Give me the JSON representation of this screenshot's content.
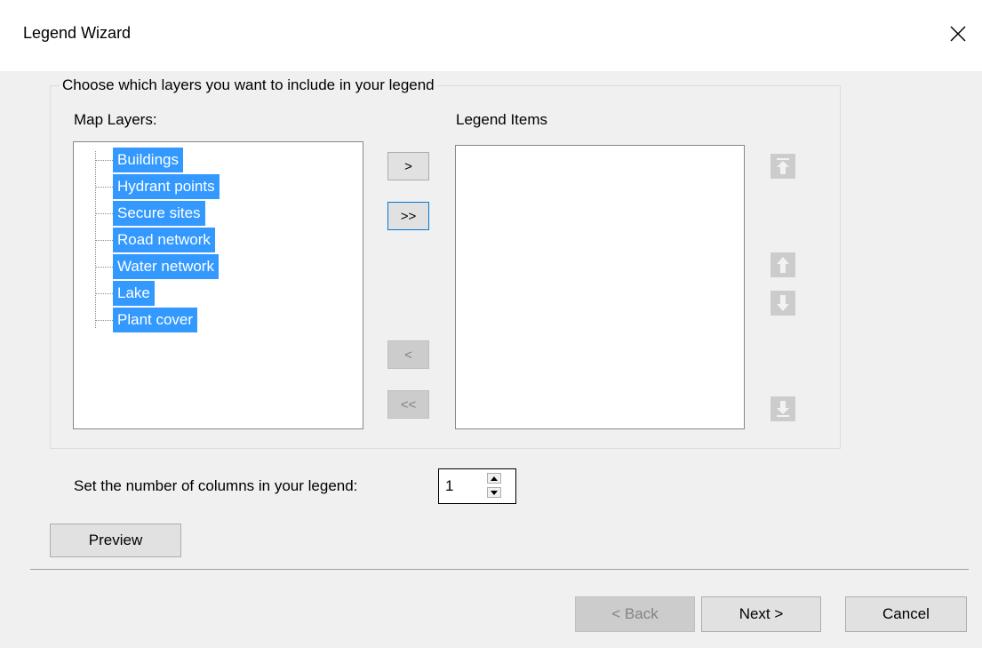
{
  "window": {
    "title": "Legend Wizard",
    "close_icon": "close-icon"
  },
  "group": {
    "caption": "Choose which layers you want to include in your legend"
  },
  "map_layers": {
    "label": "Map Layers:",
    "items": [
      "Buildings",
      "Hydrant points",
      "Secure sites",
      "Road network",
      "Water network",
      "Lake",
      "Plant cover"
    ],
    "all_selected": true
  },
  "legend_items": {
    "label": "Legend Items",
    "items": []
  },
  "transfer_buttons": {
    "add_one": ">",
    "add_all": ">>",
    "remove_one": "<",
    "remove_all": "<<"
  },
  "order_buttons": {
    "move_top_icon": "move-to-top-icon",
    "move_up_icon": "arrow-up-icon",
    "move_down_icon": "arrow-down-icon",
    "move_bottom_icon": "move-to-bottom-icon"
  },
  "columns": {
    "label": "Set the number of columns in your legend:",
    "value": "1"
  },
  "preview_label": "Preview",
  "footer": {
    "back": "< Back",
    "next": "Next >",
    "cancel": "Cancel"
  },
  "colors": {
    "selection": "#3399ff",
    "focus_border": "#0078d7",
    "disabled_button": "#cccccc"
  }
}
